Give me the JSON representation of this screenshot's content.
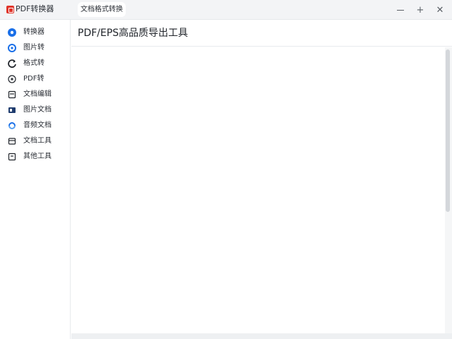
{
  "window": {
    "app_title": "PDF转换器",
    "tab_label": "文档格式转换",
    "icons": {
      "logo": "app-logo-icon",
      "minimize": "minimize-icon",
      "maximize": "maximize-icon",
      "close": "close-icon"
    },
    "brand_color": "#e0352b"
  },
  "sidebar": {
    "items": [
      {
        "label": "转换器",
        "icon": "compass-icon",
        "color": "#1a6fe8"
      },
      {
        "label": "图片转",
        "icon": "swirl-icon",
        "color": "#1a6fe8"
      },
      {
        "label": "格式转",
        "icon": "refresh-icon",
        "color": "#1f2329"
      },
      {
        "label": "PDF转",
        "icon": "pdf-icon",
        "color": "#1f2329"
      },
      {
        "label": "文档编辑",
        "icon": "document-edit-icon",
        "color": "#1f2329"
      },
      {
        "label": "图片文档",
        "icon": "image-doc-icon",
        "color": "#1f2329"
      },
      {
        "label": "音频文档",
        "icon": "audio-doc-icon",
        "color": "#1a6fe8"
      },
      {
        "label": "文档工具",
        "icon": "toolbox-icon",
        "color": "#1f2329"
      },
      {
        "label": "其他工具",
        "icon": "other-tools-icon",
        "color": "#1f2329"
      }
    ]
  },
  "main": {
    "title": "PDF/EPS高品质导出工具"
  }
}
